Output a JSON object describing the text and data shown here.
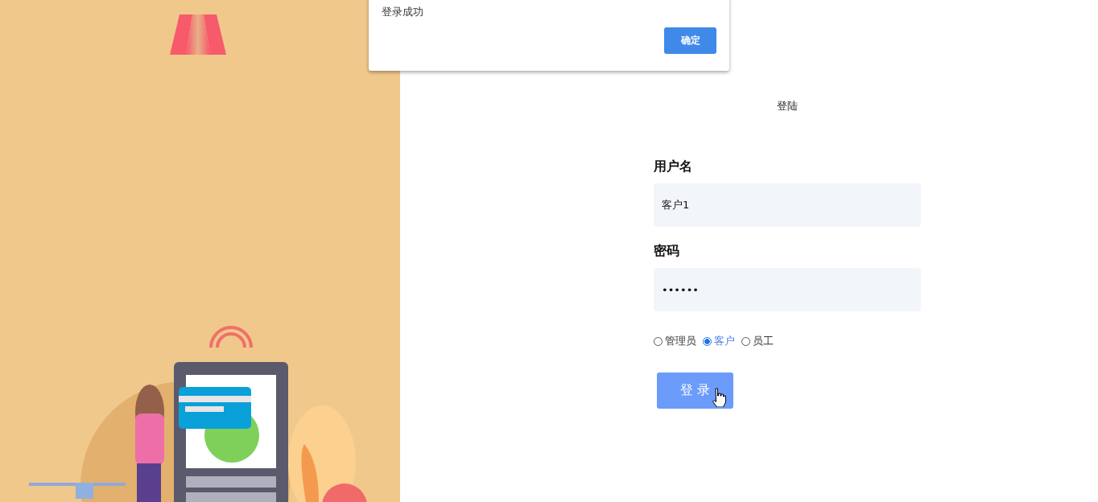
{
  "dialog": {
    "message": "登录成功",
    "button": "确定"
  },
  "login": {
    "title": "登陆",
    "fields": [
      {
        "label": "用户名",
        "value": "客户1"
      },
      {
        "label": "密码",
        "value": "••••••"
      }
    ],
    "roles": [
      {
        "label": "管理员",
        "selected": false
      },
      {
        "label": "客户",
        "selected": true
      },
      {
        "label": "员工",
        "selected": false
      }
    ],
    "submit": "登 录"
  }
}
